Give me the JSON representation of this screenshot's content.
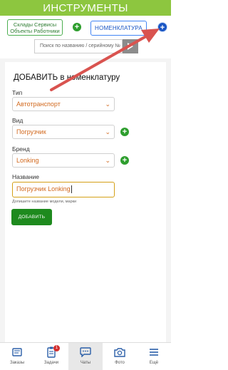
{
  "header": {
    "title": "ИНСТРУМЕНТЫ"
  },
  "top": {
    "left_button_line1": "Склады Сервисы",
    "left_button_line2": "Объекты Работники",
    "right_button": "НОМЕНКЛАТУРА"
  },
  "search": {
    "placeholder": "Поиск по названию / серийному №"
  },
  "form": {
    "title": "ДОБАВИТЬ в номенклатуру",
    "type_label": "Тип",
    "type_value": "Автотранспорт",
    "kind_label": "Вид",
    "kind_value": "Погрузчик",
    "brand_label": "Бренд",
    "brand_value": "Lonking",
    "name_label": "Название",
    "name_value": "Погрузчик Lonking",
    "name_hint": "Допишите название модели, марки",
    "submit_label": "ДОБАВИТЬ"
  },
  "nav": {
    "items": [
      {
        "label": "Заказы",
        "icon": "orders-icon"
      },
      {
        "label": "Задачи",
        "icon": "tasks-icon",
        "badge": "1"
      },
      {
        "label": "Чаты",
        "icon": "chat-icon",
        "active": true
      },
      {
        "label": "Фото",
        "icon": "camera-icon"
      },
      {
        "label": "Ещё",
        "icon": "menu-icon"
      }
    ]
  },
  "colors": {
    "header": "#8dc63f",
    "accent_green": "#1e8a1e",
    "accent_blue": "#1a56c4",
    "value_text": "#d2691e",
    "annotation_arrow": "#d9534f"
  }
}
